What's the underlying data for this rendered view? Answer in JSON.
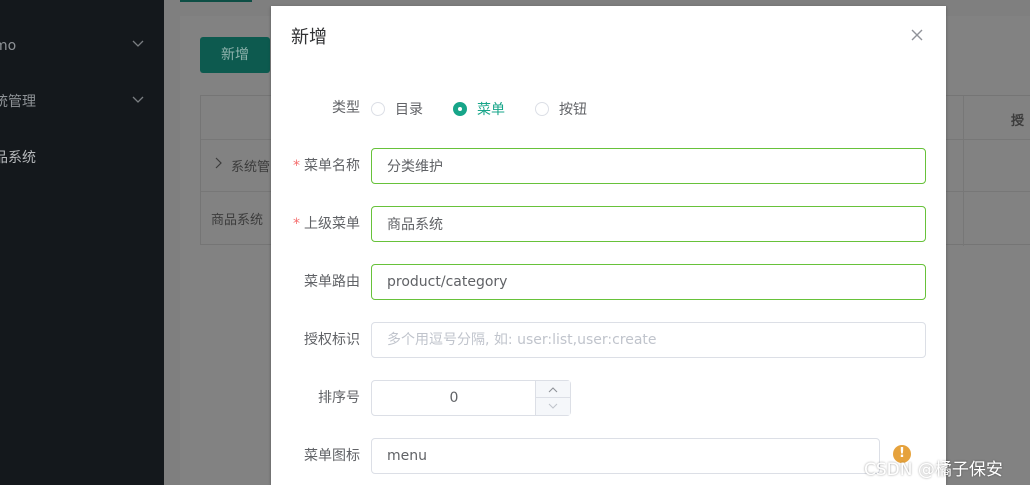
{
  "sidebar": {
    "items": [
      {
        "label": "mo"
      },
      {
        "label": "统管理"
      },
      {
        "label": "品系统"
      }
    ]
  },
  "background": {
    "add_button": "新增",
    "table": {
      "header_right": "授",
      "rows": [
        "系统管",
        "商品系统"
      ]
    }
  },
  "dialog": {
    "title": "新增",
    "fields": {
      "type": {
        "label": "类型",
        "options": [
          "目录",
          "菜单",
          "按钮"
        ],
        "selected": "菜单"
      },
      "menu_name": {
        "label": "菜单名称",
        "value": "分类维护",
        "required": true
      },
      "parent_menu": {
        "label": "上级菜单",
        "value": "商品系统",
        "required": true
      },
      "menu_route": {
        "label": "菜单路由",
        "value": "product/category"
      },
      "permission": {
        "label": "授权标识",
        "value": "",
        "placeholder": "多个用逗号分隔, 如: user:list,user:create"
      },
      "sort_order": {
        "label": "排序号",
        "value": "0"
      },
      "menu_icon": {
        "label": "菜单图标",
        "value": "menu",
        "warning_glyph": "!"
      }
    }
  },
  "watermark": "CSDN @橘子保安",
  "colors": {
    "accent": "#17a589",
    "valid_border": "#67c23a",
    "required": "#f56c6c",
    "warning": "#e6a23c"
  }
}
